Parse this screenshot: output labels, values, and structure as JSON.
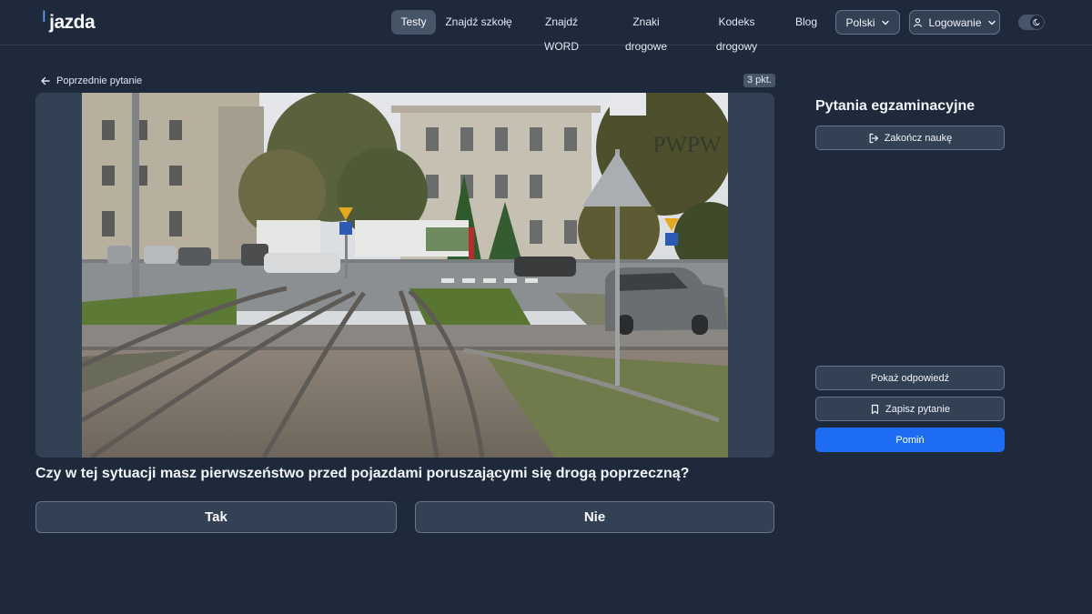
{
  "header": {
    "logo": "jazda",
    "nav": [
      {
        "label": "Testy",
        "active": true
      },
      {
        "label": "Znajdź szkołę",
        "active": false
      },
      {
        "label": "Znajdź WORD",
        "active": false
      },
      {
        "label": "Znaki drogowe",
        "active": false
      },
      {
        "label": "Kodeks drogowy",
        "active": false
      },
      {
        "label": "Blog",
        "active": false
      }
    ],
    "language": "Polski",
    "login": "Logowanie",
    "theme_toggle_icon": "moon-icon"
  },
  "question": {
    "prev_label": "Poprzednie pytanie",
    "points": "3 pkt.",
    "image_watermark": "PWPW",
    "text": "Czy w tej sytuacji masz pierwszeństwo przed pojazdami poruszającymi się drogą poprzeczną?",
    "answers": [
      "Tak",
      "Nie"
    ]
  },
  "panel": {
    "title": "Pytania egzaminacyjne",
    "end_label": "Zakończ naukę",
    "show_answer_label": "Pokaż odpowiedź",
    "save_label": "Zapisz pytanie",
    "skip_label": "Pomiń"
  },
  "colors": {
    "background": "#1e293b",
    "card": "#334155",
    "primary": "#1d6cf2"
  }
}
